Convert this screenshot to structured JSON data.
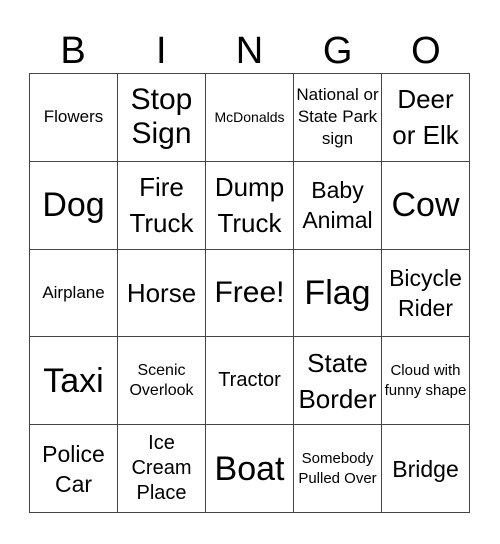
{
  "title_letters": [
    "B",
    "I",
    "N",
    "G",
    "O"
  ],
  "cells": [
    [
      "Flowers",
      "Stop Sign",
      "McDonalds",
      "National or State Park sign",
      "Deer or Elk"
    ],
    [
      "Dog",
      "Fire Truck",
      "Dump Truck",
      "Baby Animal",
      "Cow"
    ],
    [
      "Airplane",
      "Horse",
      "Free!",
      "Flag",
      "Bicycle Rider"
    ],
    [
      "Taxi",
      "Scenic Overlook",
      "Tractor",
      "State Border",
      "Cloud with funny shape"
    ],
    [
      "Police Car",
      "Ice Cream Place",
      "Boat",
      "Somebody Pulled Over",
      "Bridge"
    ]
  ],
  "colors": {
    "background": "#ffffff",
    "text": "#000000",
    "grid_line": "#444444"
  }
}
